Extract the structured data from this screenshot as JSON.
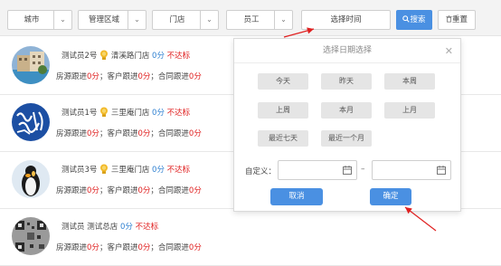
{
  "filters": {
    "city": "城市",
    "region": "管理区域",
    "store": "门店",
    "employee": "员工",
    "time": "选择时间",
    "search": "搜索",
    "reset": "重置"
  },
  "list": [
    {
      "name": "测试员2号",
      "store": "清溪路门店",
      "score": "0分",
      "status": "不达标",
      "has_medal": true,
      "stats": [
        {
          "label": "房源跟进",
          "value": "0分"
        },
        {
          "label": "客户跟进",
          "value": "0分"
        },
        {
          "label": "合同跟进",
          "value": "0分"
        }
      ]
    },
    {
      "name": "测试员1号",
      "store": "三里庵门店",
      "score": "0分",
      "status": "不达标",
      "has_medal": true,
      "stats": [
        {
          "label": "房源跟进",
          "value": "0分"
        },
        {
          "label": "客户跟进",
          "value": "0分"
        },
        {
          "label": "合同跟进",
          "value": "0分"
        }
      ]
    },
    {
      "name": "测试员3号",
      "store": "三里庵门店",
      "score": "0分",
      "status": "不达标",
      "has_medal": true,
      "stats": [
        {
          "label": "房源跟进",
          "value": "0分"
        },
        {
          "label": "客户跟进",
          "value": "0分"
        },
        {
          "label": "合同跟进",
          "value": "0分"
        }
      ]
    },
    {
      "name": "测试员",
      "store": "测试总店",
      "score": "0分",
      "status": "不达标",
      "has_medal": false,
      "stats": [
        {
          "label": "房源跟进",
          "value": "0分"
        },
        {
          "label": "客户跟进",
          "value": "0分"
        },
        {
          "label": "合同跟进",
          "value": "0分"
        }
      ]
    }
  ],
  "modal": {
    "title": "选择日期选择",
    "quick": [
      "今天",
      "昨天",
      "本周",
      "上周",
      "本月",
      "上月",
      "最近七天",
      "最近一个月"
    ],
    "custom_label": "自定义：",
    "dash": "–",
    "cancel": "取消",
    "ok": "确定"
  },
  "colors": {
    "accent": "#4a90e2",
    "score": "#2f80d1",
    "fail": "#e02020",
    "annotation": "#e02020"
  }
}
